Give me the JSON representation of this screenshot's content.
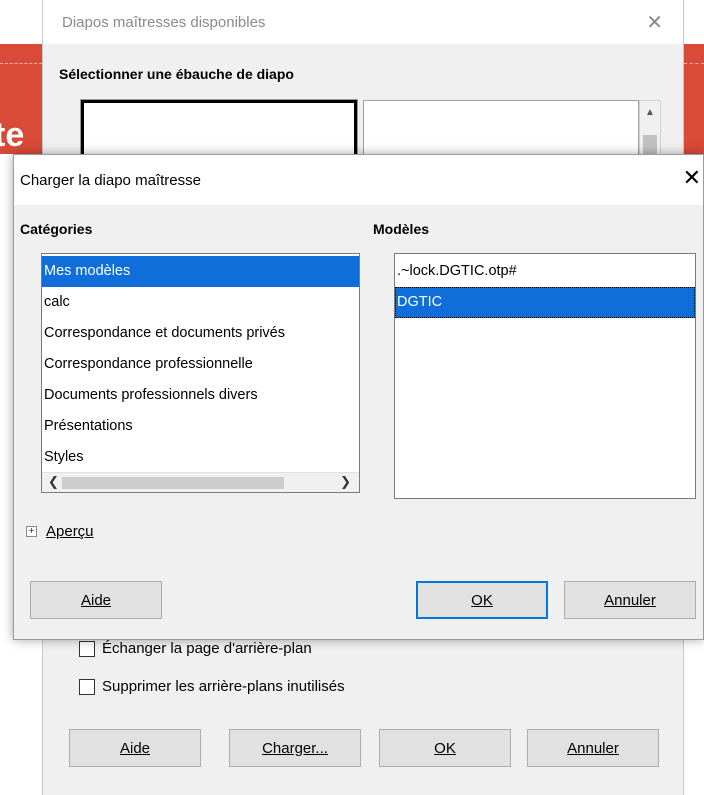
{
  "back_dialog": {
    "title": "Diapos maîtresses disponibles",
    "heading": "Sélectionner une ébauche de diapo",
    "checkbox_exchange": "Échanger la page d'arrière-plan",
    "checkbox_delete": "Supprimer les arrière-plans inutilisés",
    "buttons": {
      "help": "Aide",
      "load": "Charger...",
      "ok": "OK",
      "cancel": "Annuler"
    },
    "background_letters": "te"
  },
  "front_dialog": {
    "title": "Charger la diapo maîtresse",
    "categories_label": "Catégories",
    "models_label": "Modèles",
    "categories": [
      "Mes modèles",
      "calc",
      "Correspondance et documents privés",
      "Correspondance professionnelle",
      "Documents professionnels divers",
      "Présentations",
      "Styles"
    ],
    "selected_category": "Mes modèles",
    "models": [
      ".~lock.DGTIC.otp#",
      "DGTIC"
    ],
    "selected_model": "DGTIC",
    "preview_label": "Aperçu",
    "buttons": {
      "help": "Aide",
      "ok": "OK",
      "cancel": "Annuler"
    }
  },
  "colors": {
    "selection": "#0f6ed9",
    "dialog_bg": "#f0f0f0",
    "slide_red": "#d94a38"
  }
}
